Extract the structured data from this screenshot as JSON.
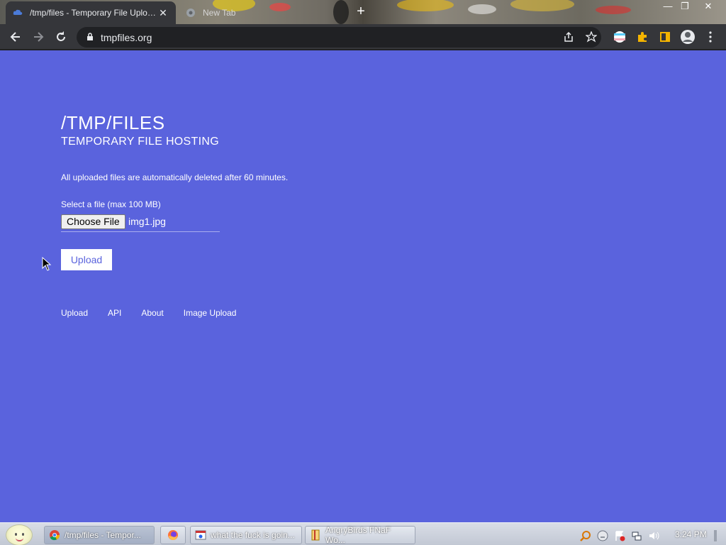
{
  "browser": {
    "tabs": [
      {
        "title": "/tmp/files - Temporary File Uplo…",
        "active": true
      },
      {
        "title": "New Tab",
        "active": false
      }
    ],
    "url": "tmpfiles.org"
  },
  "page": {
    "title": "/TMP/FILES",
    "subtitle": "TEMPORARY FILE HOSTING",
    "notice": "All uploaded files are automatically deleted after 60 minutes.",
    "file_label": "Select a file (max 100 MB)",
    "choose_button": "Choose File",
    "file_name": "img1.jpg",
    "upload_button": "Upload",
    "nav": [
      "Upload",
      "API",
      "About",
      "Image Upload"
    ],
    "background_color": "#5a63dd"
  },
  "taskbar": {
    "tasks": [
      {
        "label": "/tmp/files - Tempor...",
        "icon": "chrome-icon",
        "active": true
      },
      {
        "label": "",
        "icon": "firefox-icon",
        "active": false
      },
      {
        "label": "what the fuck is goin...",
        "icon": "browser-window-icon",
        "active": false
      },
      {
        "label": "AngryBirds FNaF Wo...",
        "icon": "document-icon",
        "active": false
      }
    ],
    "clock": "3:24 PM"
  }
}
